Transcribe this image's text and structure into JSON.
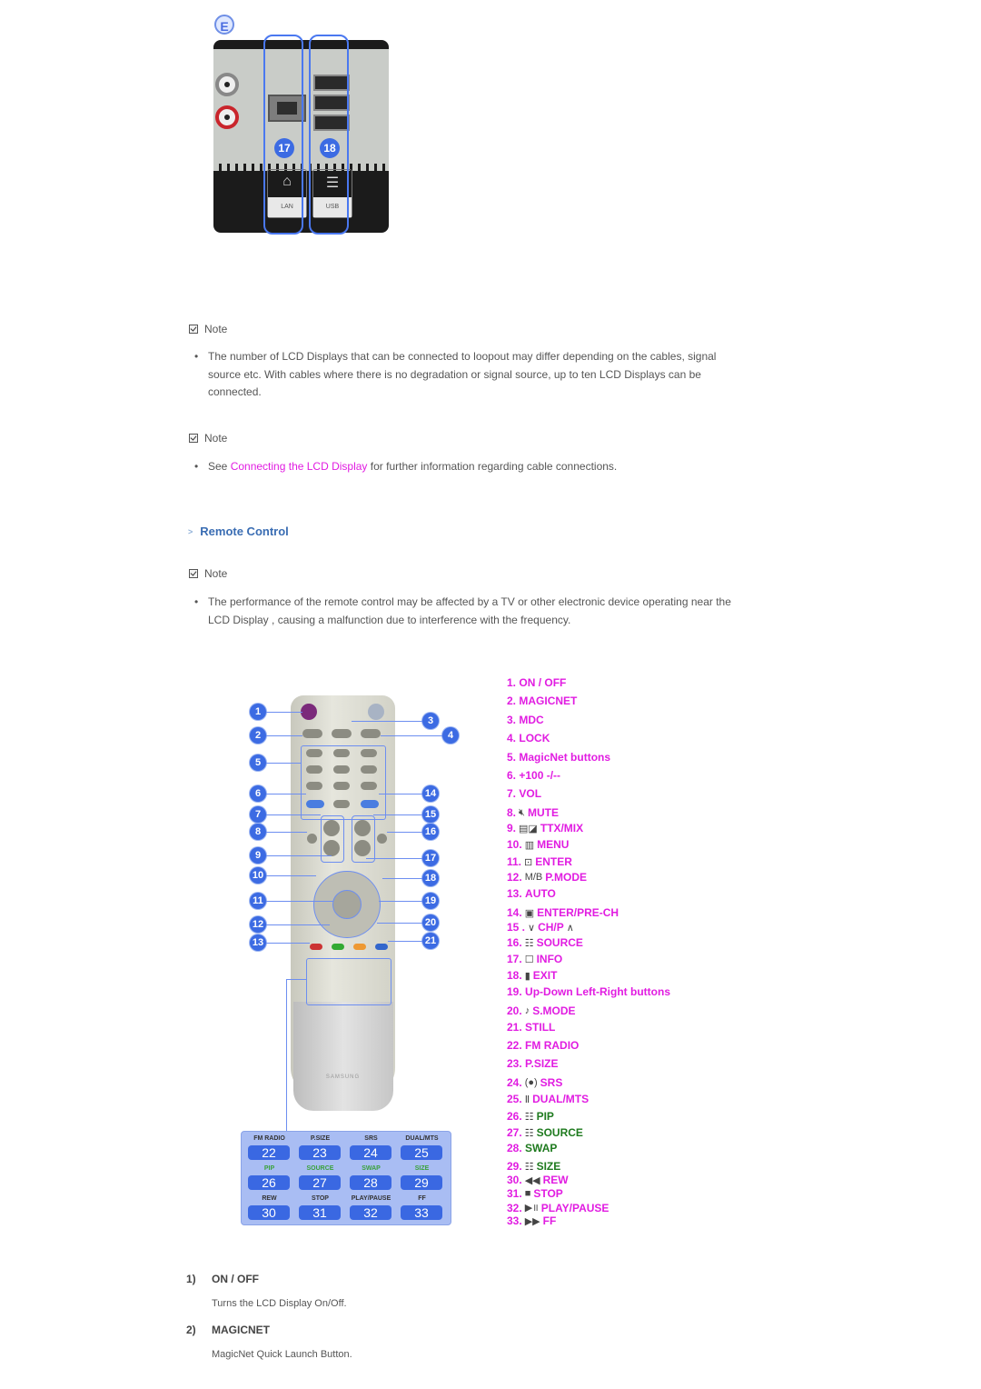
{
  "photo": {
    "section_badge": "E",
    "callouts": [
      "17",
      "18"
    ],
    "port_labels": [
      "LAN",
      "USB"
    ]
  },
  "notes": [
    {
      "heading": "Note",
      "bullets": [
        {
          "text": "The number of LCD Displays that can be connected to loopout may differ depending on the cables, signal source etc. With cables where there is no degradation or signal source, up to ten LCD Displays can be connected."
        }
      ]
    },
    {
      "heading": "Note",
      "bullets": [
        {
          "prefix": "See ",
          "link": "Connecting the LCD Display",
          "suffix": " for further information regarding cable connections."
        }
      ]
    }
  ],
  "remote_section": {
    "title": "Remote Control",
    "note_heading": "Note",
    "note_text": "The performance of the remote control may be affected by a TV or other electronic device operating near the LCD Display , causing a malfunction due to interference with the frequency."
  },
  "remote_image": {
    "callouts_left": [
      "1",
      "2",
      "5",
      "6",
      "7",
      "8",
      "9",
      "10",
      "11",
      "12",
      "13"
    ],
    "callouts_right": [
      "3",
      "4",
      "14",
      "15",
      "16",
      "17",
      "18",
      "19",
      "20",
      "21"
    ],
    "brand": "SAMSUNG",
    "keypad": [
      {
        "label": "FM RADIO",
        "num": "22",
        "color": "dark"
      },
      {
        "label": "P.SIZE",
        "num": "23",
        "color": "dark"
      },
      {
        "label": "SRS",
        "num": "24",
        "color": "dark"
      },
      {
        "label": "DUAL/MTS",
        "num": "25",
        "color": "dark"
      },
      {
        "label": "PIP",
        "num": "26",
        "color": "green"
      },
      {
        "label": "SOURCE",
        "num": "27",
        "color": "green"
      },
      {
        "label": "SWAP",
        "num": "28",
        "color": "green"
      },
      {
        "label": "SIZE",
        "num": "29",
        "color": "green"
      },
      {
        "label": "REW",
        "num": "30",
        "color": "dark"
      },
      {
        "label": "STOP",
        "num": "31",
        "color": "dark"
      },
      {
        "label": "PLAY/PAUSE",
        "num": "32",
        "color": "dark"
      },
      {
        "label": "FF",
        "num": "33",
        "color": "dark"
      }
    ]
  },
  "legend": [
    {
      "num": "1.",
      "icon": "",
      "label": "ON / OFF",
      "color": "pink"
    },
    {
      "num": "2.",
      "icon": "",
      "label": "MAGICNET",
      "color": "pink"
    },
    {
      "num": "3.",
      "icon": "",
      "label": "MDC",
      "color": "pink"
    },
    {
      "num": "4.",
      "icon": "",
      "label": "LOCK",
      "color": "pink"
    },
    {
      "num": "5.",
      "icon": "",
      "label": "MagicNet buttons",
      "color": "pink"
    },
    {
      "num": "6.",
      "icon": "",
      "label": "+100 -/--",
      "color": "pink"
    },
    {
      "num": "7.",
      "icon": "",
      "label": "VOL",
      "color": "pink"
    },
    {
      "num": "8.",
      "icon": "mute-icon",
      "label": "MUTE",
      "color": "pink"
    },
    {
      "num": "9.",
      "icon": "ttx-mix-icon",
      "label": "TTX/MIX",
      "color": "pink"
    },
    {
      "num": "10.",
      "icon": "menu-icon",
      "label": "MENU",
      "color": "pink"
    },
    {
      "num": "11.",
      "icon": "enter-icon",
      "label": "ENTER",
      "color": "pink"
    },
    {
      "num": "12.",
      "icon": "mb-icon",
      "label": "P.MODE",
      "color": "pink"
    },
    {
      "num": "13.",
      "icon": "",
      "label": "AUTO",
      "color": "pink"
    },
    {
      "num": "14.",
      "icon": "pre-ch-icon",
      "label": "ENTER/PRE-CH",
      "color": "pink"
    },
    {
      "num": "15 .",
      "icon": "chevron-down-icon",
      "label": "CH/P",
      "suffix_icon": "chevron-up-icon",
      "color": "pink"
    },
    {
      "num": "16.",
      "icon": "source-icon",
      "label": "SOURCE",
      "color": "pink"
    },
    {
      "num": "17.",
      "icon": "info-icon",
      "label": "INFO",
      "color": "pink"
    },
    {
      "num": "18.",
      "icon": "exit-icon",
      "label": "EXIT",
      "color": "pink"
    },
    {
      "num": "19.",
      "icon": "",
      "label": "Up-Down Left-Right buttons",
      "color": "pink"
    },
    {
      "num": "20.",
      "icon": "s-mode-icon",
      "label": "S.MODE",
      "color": "pink"
    },
    {
      "num": "21.",
      "icon": "",
      "label": "STILL",
      "color": "pink"
    },
    {
      "num": "22.",
      "icon": "",
      "label": "FM RADIO",
      "color": "pink"
    },
    {
      "num": "23.",
      "icon": "",
      "label": "P.SIZE",
      "color": "pink"
    },
    {
      "num": "24.",
      "icon": "srs-icon",
      "label": "SRS",
      "color": "pink"
    },
    {
      "num": "25.",
      "icon": "dual-icon",
      "label": "DUAL/MTS",
      "color": "pink"
    },
    {
      "num": "26.",
      "icon": "pip-icon",
      "label": "PIP",
      "color": "green"
    },
    {
      "num": "27.",
      "icon": "source-icon",
      "label": "SOURCE",
      "color": "green"
    },
    {
      "num": "28.",
      "icon": "",
      "label": "SWAP",
      "color": "green"
    },
    {
      "num": "29.",
      "icon": "size-icon",
      "label": "SIZE",
      "color": "green"
    },
    {
      "num": "30.",
      "icon": "rewind-icon",
      "label": "REW",
      "color": "pink"
    },
    {
      "num": "31.",
      "icon": "stop-icon",
      "label": "STOP",
      "color": "pink"
    },
    {
      "num": "32.",
      "icon": "play-pause-icon",
      "label": "PLAY/PAUSE",
      "color": "pink"
    },
    {
      "num": "33.",
      "icon": "fast-forward-icon",
      "label": "FF",
      "color": "pink"
    }
  ],
  "details": [
    {
      "num": "1)",
      "title": "ON / OFF",
      "desc": "Turns the LCD Display On/Off."
    },
    {
      "num": "2)",
      "title": "MAGICNET",
      "desc": "MagicNet Quick Launch Button."
    }
  ],
  "colors": {
    "pink": "#e11ce1",
    "green": "#1e7a1e",
    "section_blue": "#3a6db3",
    "callout_blue": "#3c6be3"
  }
}
